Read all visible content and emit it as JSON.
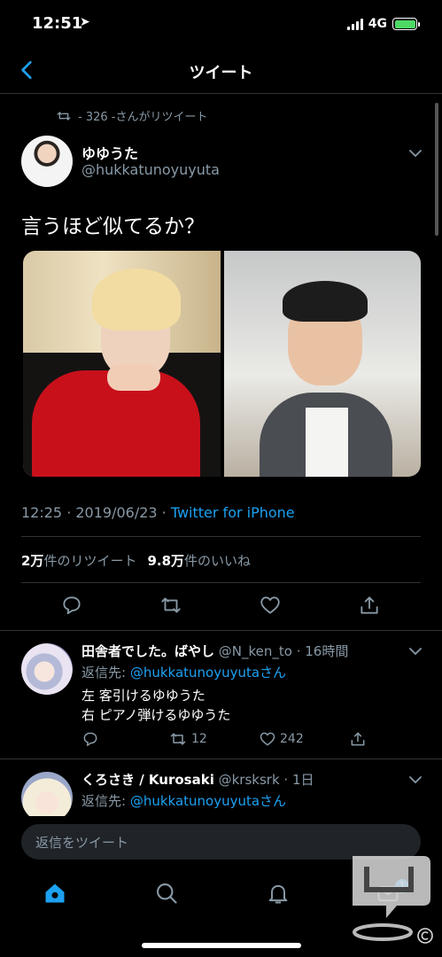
{
  "status": {
    "time": "12:51",
    "network": "4G"
  },
  "nav": {
    "title": "ツイート"
  },
  "retweet_line": "- 326 -さんがリツイート",
  "tweet": {
    "author_name": "ゆゆうた",
    "author_handle": "@hukkatunoyuyuta",
    "text": "言うほど似てるか？",
    "time": "12:25 · 2019/06/23 · ",
    "source": "Twitter for iPhone",
    "retweets_count": "2万",
    "retweets_label": "件のリツイート",
    "likes_count": "9.8万",
    "likes_label": "件のいいね"
  },
  "replies": [
    {
      "name": "田舎者でした。ばやし",
      "meta": " @N_ken_to · 16時間",
      "reply_to_label": "返信先: ",
      "reply_to_handle": "@hukkatunoyuyutaさん",
      "line1": "左 客引けるゆゆうた",
      "line2": "右 ピアノ弾けるゆゆうた",
      "retweets": "12",
      "likes": "242"
    },
    {
      "name": "くろさき / Kurosaki",
      "meta": " @krsksrk · 1日",
      "reply_to_label": "返信先: ",
      "reply_to_handle": "@hukkatunoyuyutaさん"
    }
  ],
  "reply_box": {
    "placeholder": "返信をツイート"
  },
  "tabbar": {
    "badge": "1"
  },
  "colors": {
    "accent": "#1da1f2",
    "muted": "#8899a6",
    "divider": "#2f3336"
  }
}
